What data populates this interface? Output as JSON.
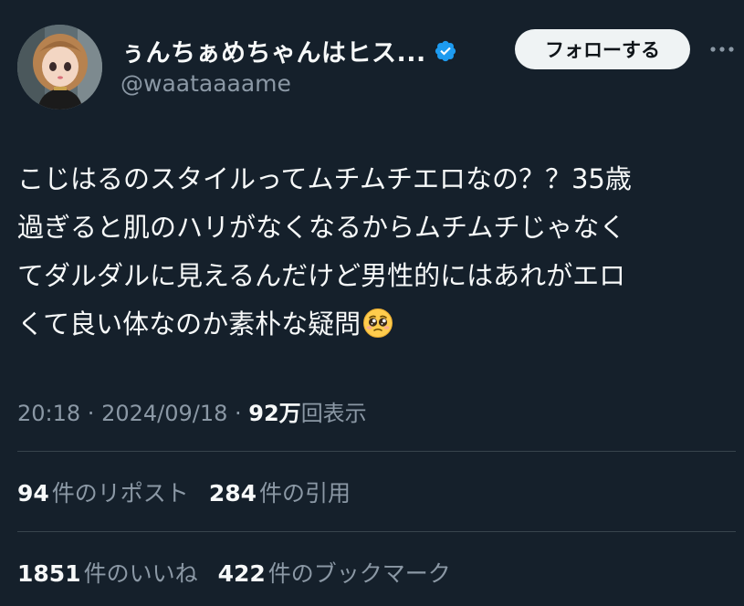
{
  "author": {
    "display_name": "ぅんちぁめちゃんはヒス...",
    "handle": "@waataaaame",
    "verified_icon": "verified-badge-icon",
    "avatar_icon": "doll-avatar"
  },
  "actions": {
    "follow_label": "フォローする",
    "more_icon": "more-horizontal-icon"
  },
  "tweet": {
    "lines": [
      "こじはるのスタイルってムチムチエロなの？？35歳",
      "過ぎると肌のハリがなくなるからムチムチじゃなく",
      "てダルダルに見えるんだけど男性的にはあれがエロ",
      "くて良い体なのか素朴な疑問"
    ],
    "emoji": "pleading-face"
  },
  "meta": {
    "time": "20:18",
    "separator": " · ",
    "date": "2024/09/18",
    "views_count": "92万",
    "views_label": "回表示"
  },
  "stats": {
    "reposts": {
      "count": "94",
      "label": "件のリポスト"
    },
    "quotes": {
      "count": "284",
      "label": "件の引用"
    },
    "likes": {
      "count": "1851",
      "label": "件のいいね"
    },
    "bookmarks": {
      "count": "422",
      "label": "件のブックマーク"
    }
  },
  "colors": {
    "background": "#15202b",
    "text_primary": "#f7f9f9",
    "text_secondary": "#8b98a5",
    "divider": "#38444d",
    "verified": "#1d9bf0"
  }
}
